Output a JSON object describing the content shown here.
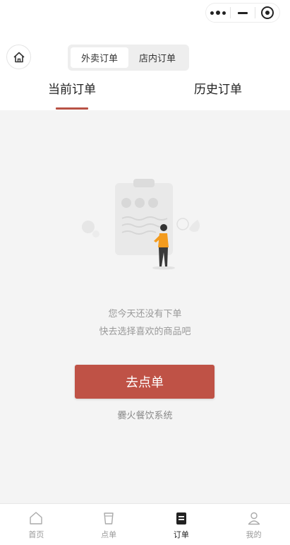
{
  "header": {
    "order_type_options": [
      "外卖订单",
      "店内订单"
    ],
    "order_type_selected": 0
  },
  "tabs": [
    {
      "label": "当前订单",
      "active": true
    },
    {
      "label": "历史订单",
      "active": false
    }
  ],
  "empty_state": {
    "line1": "您今天还没有下单",
    "line2": "快去选择喜欢的商品吧",
    "button_label": "去点单"
  },
  "brand": "爨火餐饮系统",
  "tabbar": [
    {
      "label": "首页",
      "icon": "home-icon",
      "active": false
    },
    {
      "label": "点单",
      "icon": "cup-icon",
      "active": false
    },
    {
      "label": "订单",
      "icon": "order-icon",
      "active": true
    },
    {
      "label": "我的",
      "icon": "user-icon",
      "active": false
    }
  ],
  "colors": {
    "accent": "#bf5246",
    "underline": "#b85245",
    "background": "#f4f4f4",
    "muted_text": "#999999"
  }
}
